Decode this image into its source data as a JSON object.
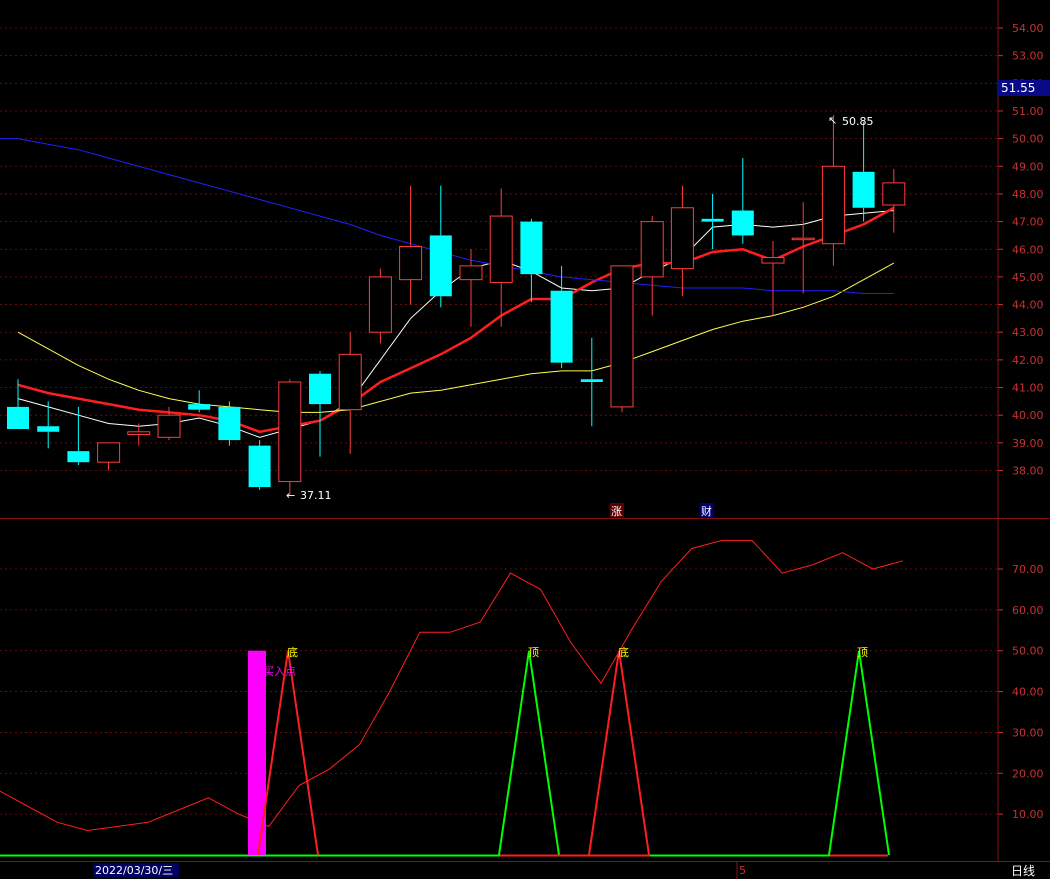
{
  "colors": {
    "background": "#000000",
    "frame": "#8a1010",
    "grid": "#7a1010",
    "up": "#ff3c3c",
    "down": "#00ffff",
    "ma_white": "#ffffff",
    "ma_red": "#ff1e1e",
    "ma_yellow": "#ffff50",
    "ma_blue": "#2020ff",
    "osc_line": "#ff1e1e",
    "top_signal": "#00ff00",
    "bottom_signal": "#ff1e1e",
    "buy_bar": "#ff00ff",
    "label_top": "#ffff00",
    "label_bottom": "#ffff00",
    "label_buy": "#ff00ff"
  },
  "axis": {
    "price_ticks": [
      "54.00",
      "53.00",
      "52.00",
      "51.00",
      "50.00",
      "49.00",
      "48.00",
      "47.00",
      "46.00",
      "45.00",
      "44.00",
      "43.00",
      "42.00",
      "41.00",
      "40.00",
      "39.00",
      "38.00"
    ],
    "osc_ticks": [
      "70.00",
      "60.00",
      "50.00",
      "40.00",
      "30.00",
      "20.00",
      "10.00"
    ],
    "current_price": "51.55",
    "date_label": "2022/03/30/三",
    "month_marker": "5",
    "period_label": "日线"
  },
  "annotations": {
    "high_label": "50.85",
    "low_label": "37.11",
    "event_1": "涨",
    "event_2": "财",
    "buy_point": "买入点",
    "top_1": "顶",
    "top_2": "顶",
    "bottom_1": "底",
    "bottom_2": "底"
  },
  "chart_data": [
    {
      "type": "candlestick",
      "ylim": [
        37,
        55
      ],
      "candles": [
        {
          "o": 40.3,
          "h": 41.3,
          "l": 39.6,
          "c": 39.5
        },
        {
          "o": 39.6,
          "h": 40.5,
          "l": 38.8,
          "c": 39.4
        },
        {
          "o": 38.7,
          "h": 40.3,
          "l": 38.2,
          "c": 38.3
        },
        {
          "o": 38.3,
          "h": 39.0,
          "l": 38.0,
          "c": 39.0
        },
        {
          "o": 39.3,
          "h": 39.7,
          "l": 38.9,
          "c": 39.4
        },
        {
          "o": 39.2,
          "h": 40.3,
          "l": 39.1,
          "c": 40.0
        },
        {
          "o": 40.4,
          "h": 40.9,
          "l": 40.1,
          "c": 40.2
        },
        {
          "o": 40.3,
          "h": 40.5,
          "l": 38.9,
          "c": 39.1
        },
        {
          "o": 38.9,
          "h": 39.1,
          "l": 37.3,
          "c": 37.4
        },
        {
          "o": 37.6,
          "h": 41.3,
          "l": 37.1,
          "c": 41.2
        },
        {
          "o": 41.5,
          "h": 41.6,
          "l": 38.5,
          "c": 40.4
        },
        {
          "o": 40.2,
          "h": 43.0,
          "l": 38.6,
          "c": 42.2
        },
        {
          "o": 43.0,
          "h": 45.3,
          "l": 42.6,
          "c": 45.0
        },
        {
          "o": 44.9,
          "h": 48.3,
          "l": 44.0,
          "c": 46.1
        },
        {
          "o": 46.5,
          "h": 48.3,
          "l": 43.9,
          "c": 44.3
        },
        {
          "o": 44.9,
          "h": 46.0,
          "l": 43.2,
          "c": 45.4
        },
        {
          "o": 44.8,
          "h": 48.2,
          "l": 43.2,
          "c": 47.2
        },
        {
          "o": 47.0,
          "h": 47.1,
          "l": 44.1,
          "c": 45.1
        },
        {
          "o": 44.5,
          "h": 45.4,
          "l": 41.7,
          "c": 41.9
        },
        {
          "o": 41.3,
          "h": 42.8,
          "l": 39.6,
          "c": 41.2
        },
        {
          "o": 40.3,
          "h": 45.4,
          "l": 40.1,
          "c": 45.4
        },
        {
          "o": 45.0,
          "h": 47.2,
          "l": 43.6,
          "c": 47.0
        },
        {
          "o": 45.3,
          "h": 48.3,
          "l": 44.3,
          "c": 47.5
        },
        {
          "o": 47.1,
          "h": 48.0,
          "l": 46.0,
          "c": 47.0
        },
        {
          "o": 47.4,
          "h": 49.3,
          "l": 46.2,
          "c": 46.5
        },
        {
          "o": 45.5,
          "h": 46.3,
          "l": 43.6,
          "c": 45.7
        },
        {
          "o": 46.4,
          "h": 47.7,
          "l": 44.4,
          "c": 46.4
        },
        {
          "o": 46.2,
          "h": 50.85,
          "l": 45.4,
          "c": 49.0
        },
        {
          "o": 48.8,
          "h": 50.6,
          "l": 47.0,
          "c": 47.5
        },
        {
          "o": 47.6,
          "h": 48.9,
          "l": 46.6,
          "c": 48.4
        }
      ],
      "ma": [
        {
          "color": "ma_white",
          "values": [
            40.6,
            40.3,
            40.0,
            39.7,
            39.6,
            39.7,
            39.9,
            39.6,
            39.2,
            39.5,
            39.8,
            40.5,
            42.0,
            43.5,
            44.5,
            45.3,
            45.6,
            45.2,
            44.6,
            44.5,
            44.6,
            45.2,
            45.7,
            46.8,
            46.9,
            46.8,
            46.9,
            47.2,
            47.3,
            47.4
          ]
        },
        {
          "color": "ma_red",
          "values": [
            41.1,
            40.8,
            40.6,
            40.4,
            40.2,
            40.1,
            40.0,
            39.8,
            39.4,
            39.6,
            39.8,
            40.4,
            41.2,
            41.7,
            42.2,
            42.8,
            43.6,
            44.2,
            44.2,
            44.8,
            45.3,
            45.5,
            45.5,
            45.9,
            46.0,
            45.6,
            46.1,
            46.5,
            46.9,
            47.5
          ]
        },
        {
          "color": "ma_yellow",
          "values": [
            43.0,
            42.4,
            41.8,
            41.3,
            40.9,
            40.6,
            40.4,
            40.3,
            40.2,
            40.1,
            40.1,
            40.2,
            40.5,
            40.8,
            40.9,
            41.1,
            41.3,
            41.5,
            41.6,
            41.6,
            41.9,
            42.3,
            42.7,
            43.1,
            43.4,
            43.6,
            43.9,
            44.3,
            44.9,
            45.5
          ]
        },
        {
          "color": "ma_blue",
          "values": [
            50.0,
            49.8,
            49.6,
            49.3,
            49.0,
            48.7,
            48.4,
            48.1,
            47.8,
            47.5,
            47.2,
            46.9,
            46.5,
            46.2,
            45.9,
            45.6,
            45.4,
            45.2,
            45.0,
            44.9,
            44.8,
            44.7,
            44.6,
            44.6,
            44.6,
            44.5,
            44.5,
            44.5,
            44.4,
            44.4
          ]
        }
      ]
    },
    {
      "type": "line",
      "ylim": [
        0,
        80
      ],
      "series": [
        {
          "color": "osc_line",
          "values": [
            16.0,
            12.0,
            8.0,
            6.0,
            7.0,
            8.0,
            11.0,
            14.0,
            10.0,
            7.0,
            17.0,
            21.0,
            27.0,
            40.0,
            54.5,
            54.5,
            57.0,
            69.0,
            65.0,
            52.0,
            42.0,
            55.0,
            67.0,
            75.0,
            77.0,
            77.0,
            69.0,
            71.0,
            74.0,
            70.0,
            72.0
          ]
        },
        {
          "color": "top_signal",
          "values": [
            0,
            0,
            0,
            0,
            0,
            0,
            0,
            0,
            0,
            0,
            0,
            0,
            0,
            0,
            0,
            0,
            0,
            50,
            0,
            0,
            0,
            0,
            0,
            0,
            0,
            0,
            0,
            0,
            50,
            0
          ]
        },
        {
          "color": "bottom_signal",
          "values": [
            0,
            0,
            0,
            0,
            0,
            0,
            0,
            0,
            0,
            50,
            0,
            0,
            0,
            0,
            0,
            0,
            0,
            0,
            0,
            0,
            50,
            0,
            0,
            0,
            0,
            0,
            0,
            0,
            0,
            0
          ]
        }
      ],
      "buy_bar": {
        "value": 50
      }
    }
  ]
}
